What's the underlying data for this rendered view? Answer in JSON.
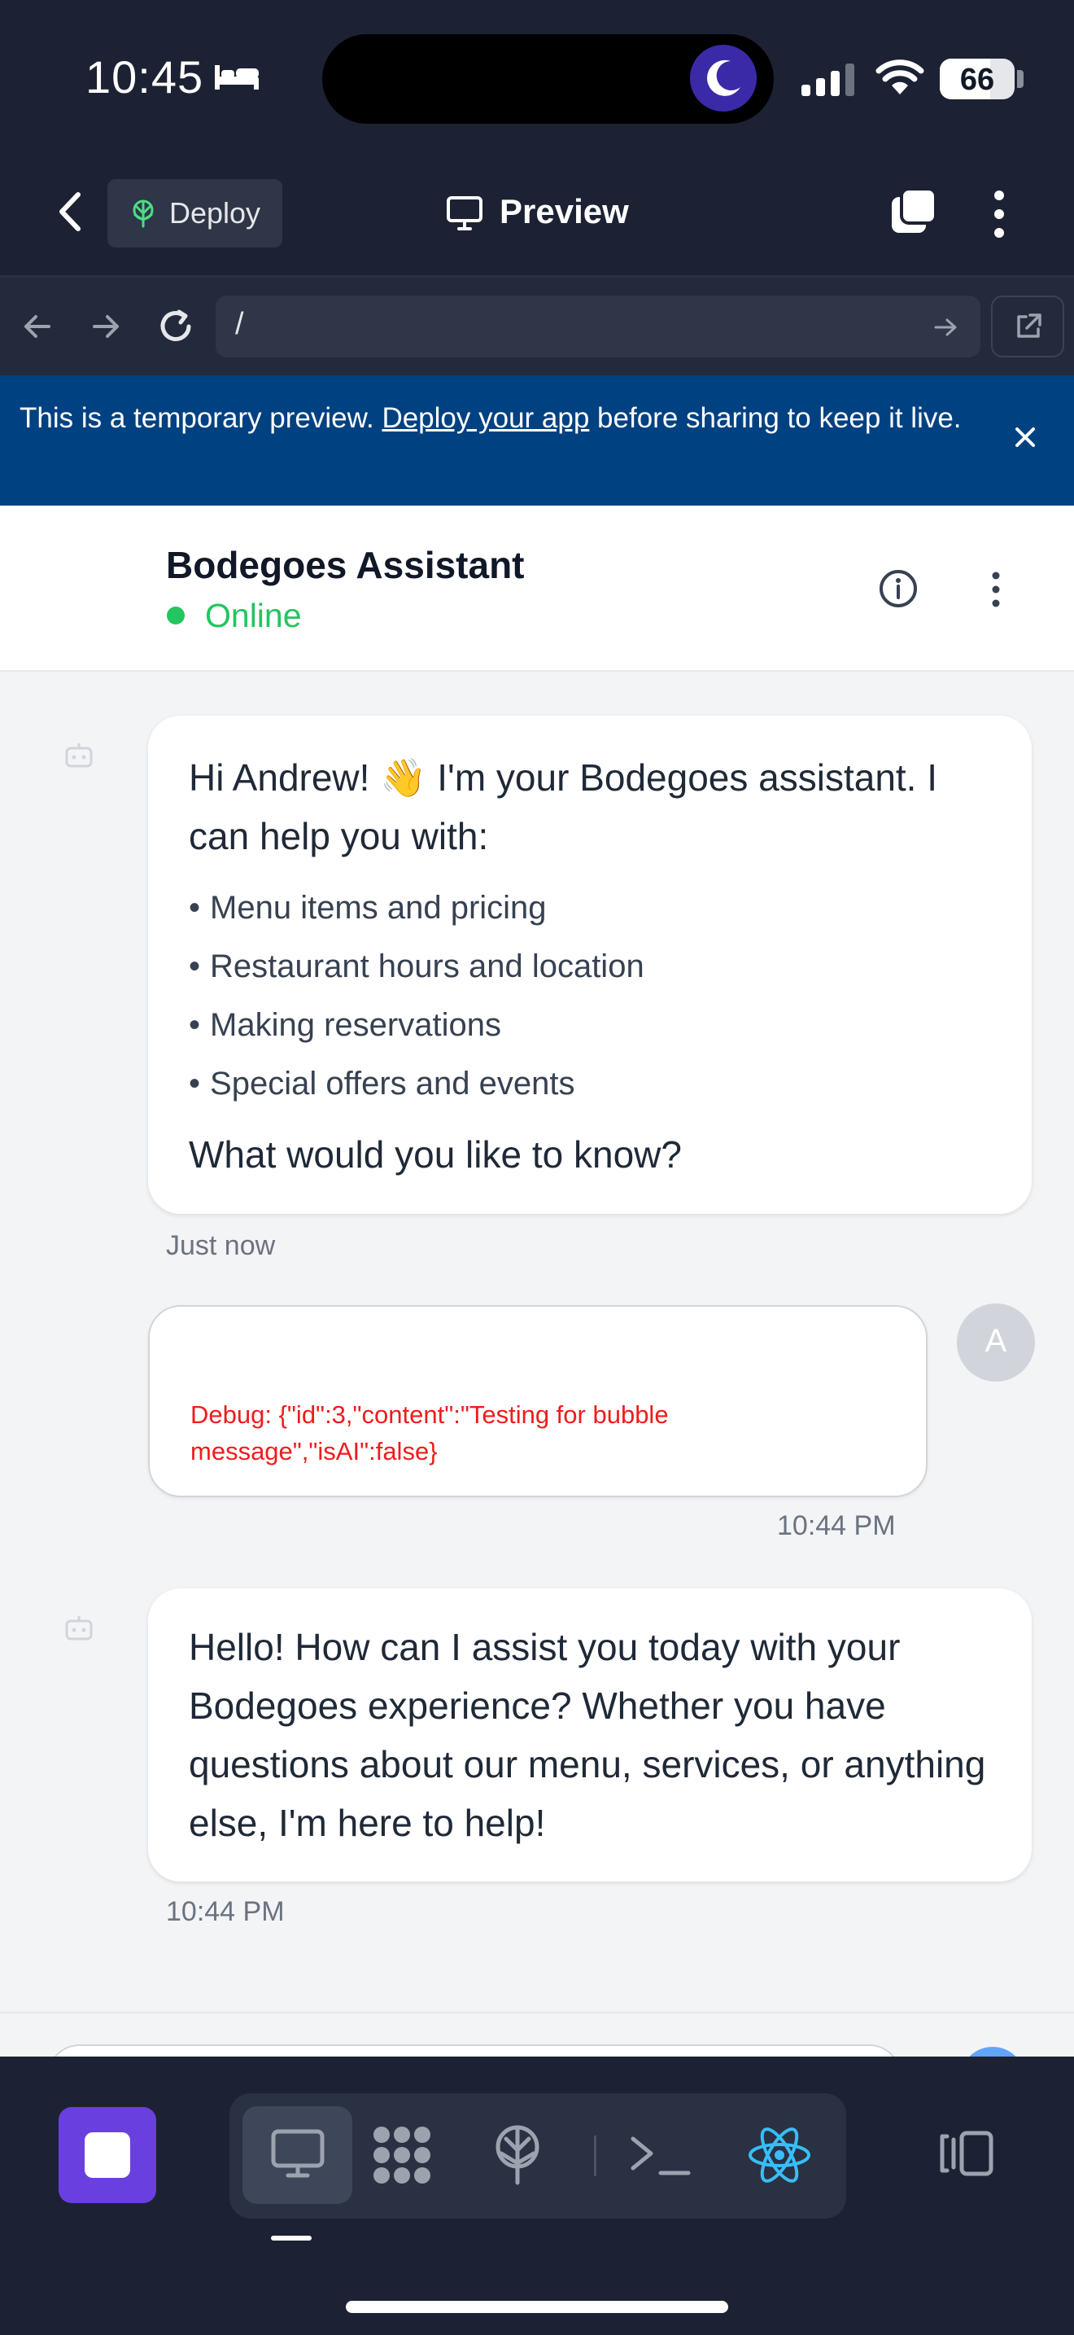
{
  "status_bar": {
    "time": "10:45",
    "battery": "66"
  },
  "nav": {
    "deploy_label": "Deploy",
    "preview_title": "Preview"
  },
  "url_bar": {
    "url": "/"
  },
  "banner": {
    "text_before": "This is a temporary preview. ",
    "link_text": "Deploy your app",
    "text_after": " before sharing to keep it live."
  },
  "chat": {
    "assistant_name": "Bodegoes Assistant",
    "status": "Online",
    "messages": [
      {
        "sender": "assistant",
        "intro": "Hi Andrew! 👋 I'm your Bodegoes assistant. I can help you with:",
        "items": [
          "Menu items and pricing",
          "Restaurant hours and location",
          "Making reservations",
          "Special offers and events"
        ],
        "outro": "What would you like to know?",
        "time": "Just now"
      },
      {
        "sender": "user",
        "debug": "Debug: {\"id\":3,\"content\":\"Testing for bubble message\",\"isAI\":false}",
        "avatar_letter": "A",
        "time": "10:44 PM"
      },
      {
        "sender": "assistant",
        "text": "Hello! How can I assist you today with your Bodegoes experience? Whether you have questions about our menu, services, or anything else, I'm here to help!",
        "time": "10:44 PM"
      }
    ]
  },
  "colors": {
    "chrome_bg": "#1c2233",
    "banner_bg": "#004182",
    "online_green": "#22c55e",
    "debug_red": "#ef1c1c",
    "stop_purple": "#6a3fe0",
    "react_cyan": "#38bdf8"
  },
  "icons": {
    "nav": [
      "back-chevron-icon",
      "deploy-icon",
      "monitor-icon",
      "tabs-icon",
      "more-vertical-icon"
    ],
    "url_bar": [
      "back-arrow-icon",
      "forward-arrow-icon",
      "reload-icon",
      "url-go-arrow-icon",
      "external-link-icon"
    ],
    "toolbar": [
      "stop-icon",
      "desktop-icon",
      "grid-icon",
      "deploy-icon",
      "terminal-icon",
      "react-icon",
      "panel-toggle-icon"
    ]
  }
}
